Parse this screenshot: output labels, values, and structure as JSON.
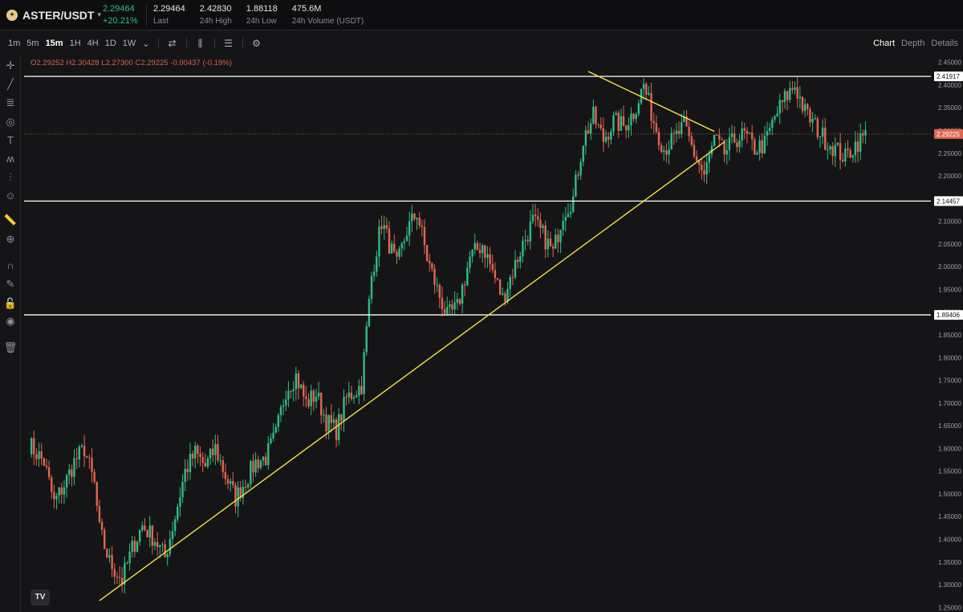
{
  "header": {
    "pair": "ASTER/USDT",
    "last_price": "2.29464",
    "change_pct": "+20.21%",
    "stats": [
      {
        "value": "2.29464",
        "label": "Last"
      },
      {
        "value": "2.42830",
        "label": "24h High"
      },
      {
        "value": "1.88118",
        "label": "24h Low"
      },
      {
        "value": "475.6M",
        "label": "24h Volume (USDT)"
      }
    ]
  },
  "toolbar": {
    "timeframes": [
      "1m",
      "5m",
      "15m",
      "1H",
      "4H",
      "1D",
      "1W"
    ],
    "active_timeframe": "15m",
    "view_tabs": [
      "Chart",
      "Depth",
      "Details"
    ],
    "active_view": "Chart"
  },
  "ohlc_text": "O2.29252 H2.30428 L2.27300 C2.29225 -0.00437 (-0.19%)",
  "colors": {
    "up": "#2ebd85",
    "down": "#e0674f",
    "trendline": "#f3e14b",
    "level": "#ffffff",
    "current_price": "#e0674f"
  },
  "chart_data": {
    "type": "candlestick",
    "ylim": [
      1.24,
      2.46
    ],
    "y_ticks": [
      "2.45000",
      "2.40000",
      "2.35000",
      "2.30000",
      "2.25000",
      "2.20000",
      "2.15000",
      "2.10000",
      "2.05000",
      "2.00000",
      "1.95000",
      "1.90000",
      "1.85000",
      "1.80000",
      "1.75000",
      "1.70000",
      "1.65000",
      "1.60000",
      "1.55000",
      "1.50000",
      "1.45000",
      "1.40000",
      "1.35000",
      "1.30000",
      "1.25000"
    ],
    "horizontal_levels": [
      {
        "value": 2.41917,
        "label": "2.41917"
      },
      {
        "value": 2.14457,
        "label": "2.14457"
      },
      {
        "value": 1.89406,
        "label": "1.89406"
      }
    ],
    "current_price": {
      "value": 2.29225,
      "label": "2.29225"
    },
    "trendlines": [
      {
        "name": "support",
        "from_index": 28,
        "from_price": 1.265,
        "to_index": 276,
        "to_price": 2.275
      },
      {
        "name": "resistance",
        "from_index": 222,
        "from_price": 2.43,
        "to_index": 272,
        "to_price": 2.298
      }
    ],
    "close_path": [
      [
        0,
        1.61
      ],
      [
        6,
        1.57
      ],
      [
        10,
        1.48
      ],
      [
        14,
        1.52
      ],
      [
        18,
        1.57
      ],
      [
        22,
        1.6
      ],
      [
        26,
        1.52
      ],
      [
        28,
        1.42
      ],
      [
        32,
        1.35
      ],
      [
        37,
        1.31
      ],
      [
        41,
        1.38
      ],
      [
        45,
        1.43
      ],
      [
        50,
        1.4
      ],
      [
        54,
        1.36
      ],
      [
        58,
        1.45
      ],
      [
        62,
        1.55
      ],
      [
        66,
        1.59
      ],
      [
        70,
        1.56
      ],
      [
        74,
        1.6
      ],
      [
        78,
        1.54
      ],
      [
        82,
        1.49
      ],
      [
        86,
        1.53
      ],
      [
        90,
        1.57
      ],
      [
        94,
        1.58
      ],
      [
        98,
        1.63
      ],
      [
        102,
        1.73
      ],
      [
        106,
        1.76
      ],
      [
        110,
        1.7
      ],
      [
        114,
        1.72
      ],
      [
        118,
        1.66
      ],
      [
        122,
        1.64
      ],
      [
        126,
        1.71
      ],
      [
        132,
        1.74
      ],
      [
        136,
        1.98
      ],
      [
        140,
        2.1
      ],
      [
        146,
        2.0
      ],
      [
        150,
        2.08
      ],
      [
        154,
        2.12
      ],
      [
        158,
        2.02
      ],
      [
        162,
        1.95
      ],
      [
        166,
        1.89
      ],
      [
        170,
        1.91
      ],
      [
        175,
        2.02
      ],
      [
        180,
        2.05
      ],
      [
        184,
        1.99
      ],
      [
        188,
        1.93
      ],
      [
        192,
        1.99
      ],
      [
        196,
        2.05
      ],
      [
        200,
        2.1
      ],
      [
        204,
        2.07
      ],
      [
        208,
        2.03
      ],
      [
        212,
        2.12
      ],
      [
        216,
        2.15
      ],
      [
        220,
        2.28
      ],
      [
        224,
        2.33
      ],
      [
        228,
        2.28
      ],
      [
        232,
        2.32
      ],
      [
        236,
        2.31
      ],
      [
        240,
        2.34
      ],
      [
        244,
        2.4
      ],
      [
        248,
        2.32
      ],
      [
        252,
        2.26
      ],
      [
        256,
        2.28
      ],
      [
        260,
        2.31
      ],
      [
        264,
        2.25
      ],
      [
        268,
        2.2
      ],
      [
        272,
        2.28
      ],
      [
        276,
        2.25
      ],
      [
        280,
        2.28
      ],
      [
        284,
        2.29
      ],
      [
        288,
        2.26
      ],
      [
        292,
        2.27
      ],
      [
        296,
        2.33
      ],
      [
        300,
        2.37
      ],
      [
        304,
        2.4
      ],
      [
        308,
        2.34
      ],
      [
        312,
        2.31
      ],
      [
        316,
        2.28
      ],
      [
        320,
        2.26
      ],
      [
        324,
        2.24
      ],
      [
        328,
        2.27
      ],
      [
        332,
        2.29
      ]
    ]
  }
}
